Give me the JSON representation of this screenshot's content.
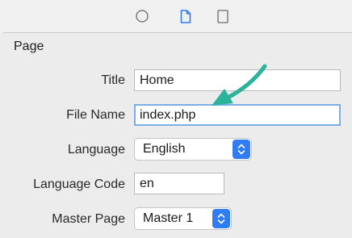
{
  "toolbar": {
    "icons": [
      "circle-icon",
      "document-icon",
      "square-icon"
    ],
    "active_color": "#2f7cf6"
  },
  "section": {
    "title": "Page"
  },
  "fields": {
    "title": {
      "label": "Title",
      "value": "Home"
    },
    "file_name": {
      "label": "File Name",
      "value": "index.php"
    },
    "language": {
      "label": "Language",
      "value": "English"
    },
    "language_code": {
      "label": "Language Code",
      "value": "en"
    },
    "master_page": {
      "label": "Master Page",
      "value": "Master 1"
    }
  },
  "annotation": {
    "icon": "arrow-icon",
    "color": "#2bb39b"
  }
}
